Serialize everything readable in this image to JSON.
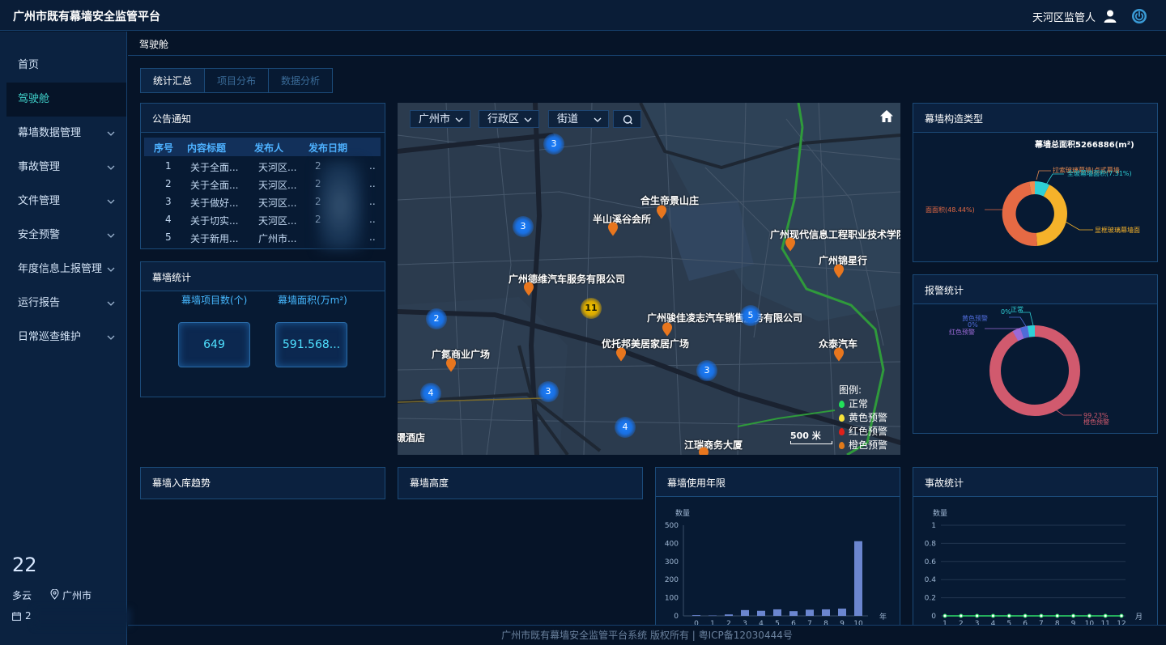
{
  "app": {
    "title": "广州市既有幕墙安全监管平台",
    "user": "天河区监管人"
  },
  "sidebar": {
    "items": [
      {
        "label": "首页",
        "active": false,
        "has_children": false
      },
      {
        "label": "驾驶舱",
        "active": true,
        "has_children": false
      },
      {
        "label": "幕墙数据管理",
        "active": false,
        "has_children": true
      },
      {
        "label": "事故管理",
        "active": false,
        "has_children": true
      },
      {
        "label": "文件管理",
        "active": false,
        "has_children": true
      },
      {
        "label": "安全预警",
        "active": false,
        "has_children": true
      },
      {
        "label": "年度信息上报管理",
        "active": false,
        "has_children": true
      },
      {
        "label": "运行报告",
        "active": false,
        "has_children": true
      },
      {
        "label": "日常巡查维护",
        "active": false,
        "has_children": true
      }
    ],
    "weather": {
      "temp": "22",
      "desc": "多云",
      "city": "广州市",
      "date": "2"
    }
  },
  "breadcrumb": "驾驶舱",
  "tabs": [
    {
      "label": "统计汇总",
      "active": true
    },
    {
      "label": "项目分布",
      "active": false
    },
    {
      "label": "数据分析",
      "active": false
    }
  ],
  "notice": {
    "title": "公告通知",
    "headers": [
      "序号",
      "内容标题",
      "发布人",
      "发布日期"
    ],
    "rows": [
      [
        "1",
        "关于全面...",
        "天河区...",
        "2",
        ".."
      ],
      [
        "2",
        "关于全面...",
        "天河区...",
        "2",
        ".."
      ],
      [
        "3",
        "关于做好...",
        "天河区...",
        "2",
        ".."
      ],
      [
        "4",
        "关于切实...",
        "天河区...",
        "2",
        ".."
      ],
      [
        "5",
        "关于新用...",
        "广州市...",
        "",
        ".."
      ]
    ]
  },
  "stats": {
    "title": "幕墙统计",
    "count_label": "幕墙项目数(个)",
    "count_value": "649",
    "area_label": "幕墙面积(万m²)",
    "area_value": "591.568..."
  },
  "map": {
    "selects": [
      "广州市",
      "行政区",
      "街道"
    ],
    "places": [
      "合生帝景山庄",
      "半山溪谷会所",
      "广州现代信息工程职业技术学院",
      "广州锦星行",
      "广州德维汽车服务有限公司",
      "广州骏佳凌志汽车销售服务有限公司",
      "优托邦美居家居广场",
      "广氮商业广场",
      "众泰汽车",
      "江瑞商务大厦",
      "璟酒店"
    ],
    "clusters": [
      "3",
      "3",
      "11",
      "2",
      "5",
      "3",
      "3",
      "4",
      "4"
    ],
    "legend_title": "图例:",
    "legend": [
      {
        "label": "正常",
        "color": "#22e05a"
      },
      {
        "label": "黄色预警",
        "color": "#f5e13a"
      },
      {
        "label": "红色预警",
        "color": "#e0201a"
      },
      {
        "label": "橙色预警",
        "color": "#e07a1a"
      }
    ],
    "scale": "500 米",
    "pin_color": "#e8761e"
  },
  "structure": {
    "title": "幕墙构造类型",
    "total_label": "幕墙总面积:",
    "total_value": "5266886(m²)",
    "labels": {
      "top1": "拉索玻璃幕墙|点式幕墙",
      "top2": "全玻幕墙面积(7.31%)",
      "left": "面面积(48.44%)",
      "right": "显框玻璃幕墙面"
    }
  },
  "alarm": {
    "title": "报警统计",
    "labels": {
      "normal_pct": "0%",
      "normal": "正常",
      "yellow": "黄色预警",
      "yellow_pct": "0%",
      "red": "红色预警",
      "orange_pct": "99.23%",
      "orange": "橙色预警"
    }
  },
  "panels_bottom": [
    "幕墙入库趋势",
    "幕墙高度"
  ],
  "chart_data": [
    {
      "type": "bar",
      "title": "幕墙使用年限",
      "ylabel": "数量",
      "xlabel": "年",
      "ylim": [
        0,
        500
      ],
      "yticks": [
        0,
        100,
        200,
        300,
        400,
        500
      ],
      "categories": [
        "0",
        "1",
        "2",
        "3",
        "4",
        "5",
        "6",
        "7",
        "8",
        "9",
        "10"
      ],
      "values": [
        4,
        2,
        8,
        32,
        28,
        36,
        26,
        34,
        36,
        40,
        412
      ],
      "color": "#6b86d0"
    },
    {
      "type": "line",
      "title": "事故统计",
      "ylabel": "数量",
      "xlabel": "月",
      "ylim": [
        0,
        1
      ],
      "yticks": [
        "0",
        "0.2",
        "0.4",
        "0.6",
        "0.8",
        "1"
      ],
      "categories": [
        "1",
        "2",
        "3",
        "4",
        "5",
        "6",
        "7",
        "8",
        "9",
        "10",
        "11",
        "12"
      ],
      "values": [
        0,
        0,
        0,
        0,
        0,
        0,
        0,
        0,
        0,
        0,
        0,
        0
      ],
      "color": "#2ee06a"
    }
  ],
  "footer": "广州市既有幕墙安全监管平台系统 版权所有 | 粤ICP备12030444号"
}
